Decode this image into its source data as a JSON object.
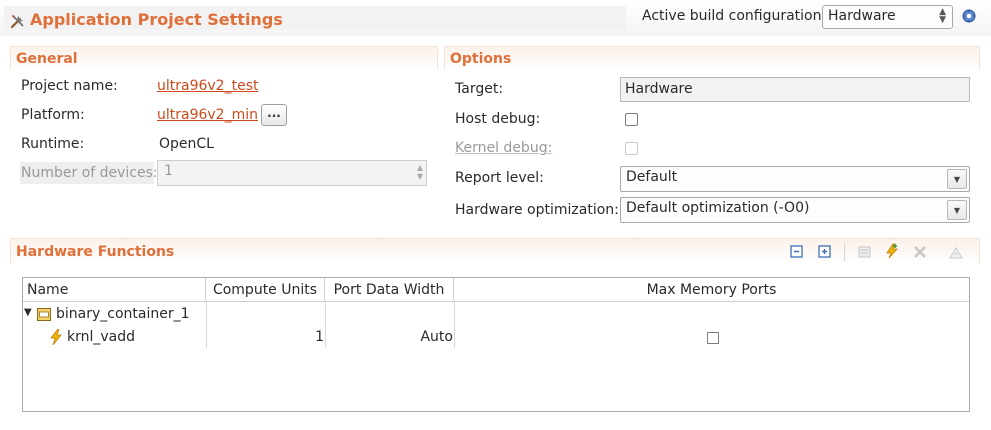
{
  "header": {
    "title": "Application Project Settings",
    "active_build_label": "Active build configuration:",
    "active_build_value": "Hardware"
  },
  "general": {
    "section_title": "General",
    "project_name_label": "Project name:",
    "project_name_value": "ultra96v2_test",
    "platform_label": "Platform:",
    "platform_value": "ultra96v2_min",
    "browse_label": "...",
    "runtime_label": "Runtime:",
    "runtime_value": "OpenCL",
    "num_devices_label": "Number of devices:",
    "num_devices_value": "1"
  },
  "options": {
    "section_title": "Options",
    "target_label": "Target:",
    "target_value": "Hardware",
    "host_debug_label": "Host debug:",
    "kernel_debug_label": "Kernel debug:",
    "report_level_label": "Report level:",
    "report_level_value": "Default",
    "hw_opt_label": "Hardware optimization:",
    "hw_opt_value": "Default optimization (-O0)"
  },
  "hardware_functions": {
    "section_title": "Hardware Functions",
    "columns": [
      "Name",
      "Compute Units",
      "Port Data Width",
      "Max Memory Ports"
    ],
    "container": {
      "name": "binary_container_1"
    },
    "kernel": {
      "name": "krnl_vadd",
      "compute_units": "1",
      "port_data_width": "Auto"
    }
  },
  "colors": {
    "accent": "#e0703a",
    "link": "#cc4a1c"
  }
}
